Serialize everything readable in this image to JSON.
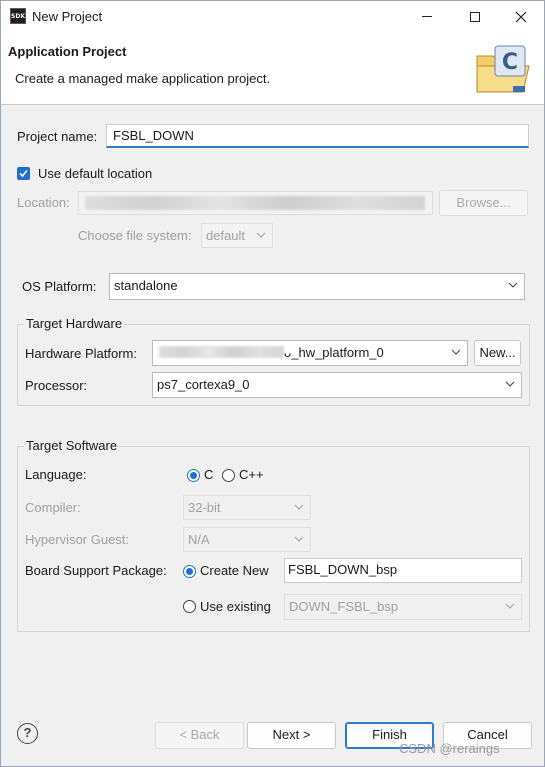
{
  "window": {
    "title": "New Project",
    "icon_text": "SDK",
    "minimize_icon": "minimize-icon",
    "maximize_icon": "maximize-icon",
    "close_icon": "close-icon"
  },
  "header": {
    "title": "Application Project",
    "description": "Create a managed make application project."
  },
  "project": {
    "name_label": "Project name:",
    "name_value": "FSBL_DOWN",
    "use_default_label": "Use default location",
    "use_default_checked": true,
    "location_label": "Location:",
    "browse_label": "Browse...",
    "file_system_label": "Choose file system:",
    "file_system_value": "default"
  },
  "os": {
    "label": "OS Platform:",
    "value": "standalone"
  },
  "target_hardware": {
    "title": "Target Hardware",
    "platform_label": "Hardware Platform:",
    "platform_value": "ᴗ_hw_platform_0",
    "new_label": "New...",
    "processor_label": "Processor:",
    "processor_value": "ps7_cortexa9_0"
  },
  "target_software": {
    "title": "Target Software",
    "language_label": "Language:",
    "lang_c": "C",
    "lang_cpp": "C++",
    "compiler_label": "Compiler:",
    "compiler_value": "32-bit",
    "hypervisor_label": "Hypervisor Guest:",
    "hypervisor_value": "N/A",
    "bsp_label": "Board Support Package:",
    "create_new_label": "Create New",
    "create_new_value": "FSBL_DOWN_bsp",
    "use_existing_label": "Use existing",
    "use_existing_value": "DOWN_FSBL_bsp"
  },
  "footer": {
    "back_label": "< Back",
    "next_label": "Next >",
    "finish_label": "Finish",
    "cancel_label": "Cancel",
    "help_icon": "help-icon"
  },
  "watermark": "CSDN @reraings",
  "colors": {
    "accent": "#1e6fd0",
    "focus_underline": "#2e7bd4",
    "disabled_text": "#a0a0a0"
  }
}
